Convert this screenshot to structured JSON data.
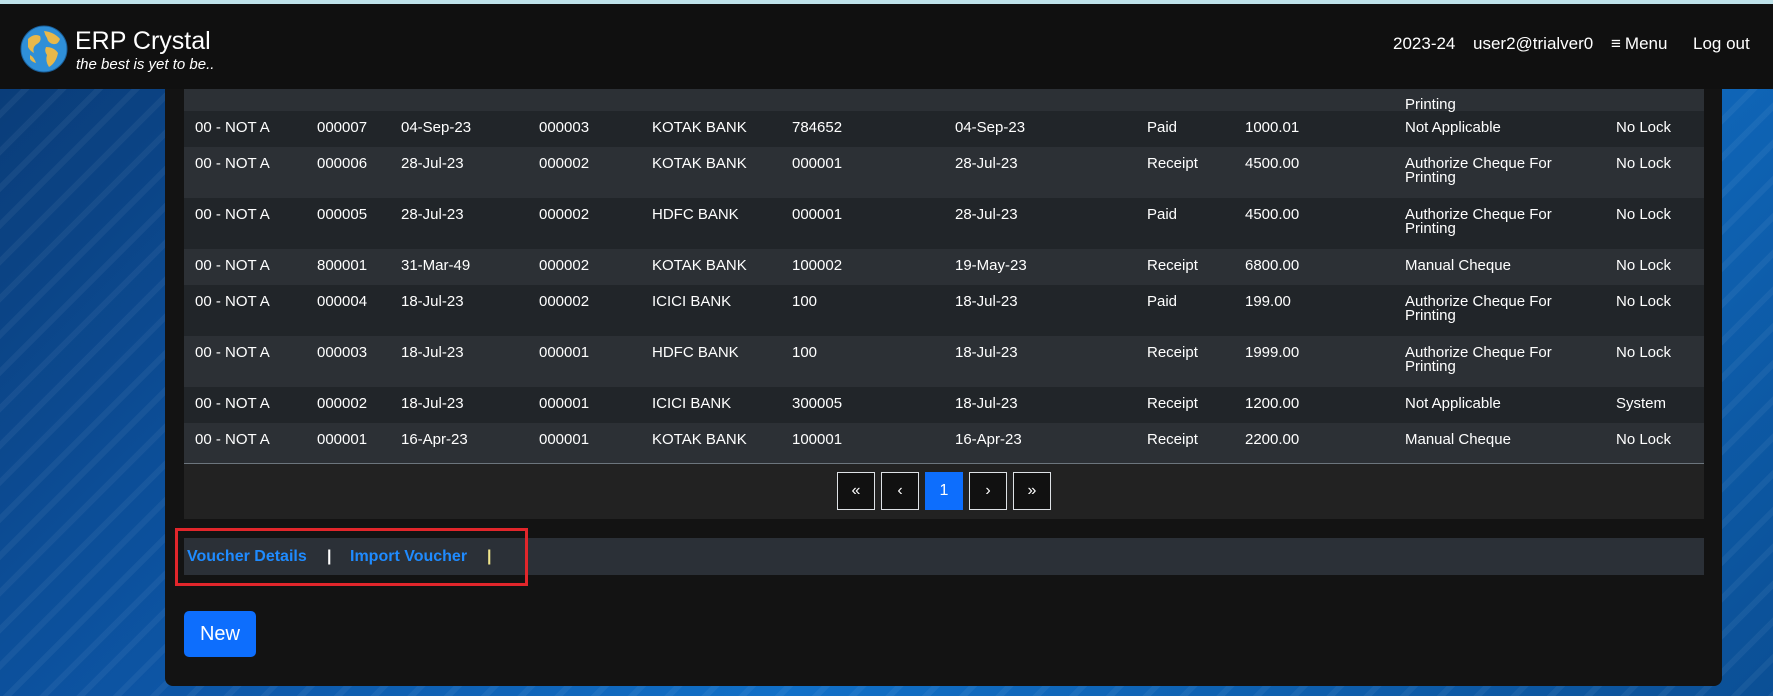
{
  "header": {
    "title": "ERP Crystal",
    "tagline": "the best is yet to be..",
    "year": "2023-24",
    "user": "user2@trialver0",
    "menu_label": "Menu",
    "logout_label": "Log out"
  },
  "partial_row": {
    "col9_line2": "Printing"
  },
  "rows": [
    {
      "c1": "00 - NOT A",
      "c2": "000007",
      "c3": "04-Sep-23",
      "c4": "000003",
      "c5": "KOTAK BANK",
      "c6": "784652",
      "c7": "04-Sep-23",
      "c8": "Paid",
      "c9": "1000.01",
      "c10a": "Not Applicable",
      "c10b": "",
      "c11": "No Lock"
    },
    {
      "c1": "00 - NOT A",
      "c2": "000006",
      "c3": "28-Jul-23",
      "c4": "000002",
      "c5": "KOTAK BANK",
      "c6": "000001",
      "c7": "28-Jul-23",
      "c8": "Receipt",
      "c9": "4500.00",
      "c10a": "Authorize Cheque For",
      "c10b": "Printing",
      "c11": "No Lock"
    },
    {
      "c1": "00 - NOT A",
      "c2": "000005",
      "c3": "28-Jul-23",
      "c4": "000002",
      "c5": "HDFC BANK",
      "c6": "000001",
      "c7": "28-Jul-23",
      "c8": "Paid",
      "c9": "4500.00",
      "c10a": "Authorize Cheque For",
      "c10b": "Printing",
      "c11": "No Lock"
    },
    {
      "c1": "00 - NOT A",
      "c2": "800001",
      "c3": "31-Mar-49",
      "c4": "000002",
      "c5": "KOTAK BANK",
      "c6": "100002",
      "c7": "19-May-23",
      "c8": "Receipt",
      "c9": "6800.00",
      "c10a": "Manual Cheque",
      "c10b": "",
      "c11": "No Lock"
    },
    {
      "c1": "00 - NOT A",
      "c2": "000004",
      "c3": "18-Jul-23",
      "c4": "000002",
      "c5": "ICICI BANK",
      "c6": "100",
      "c7": "18-Jul-23",
      "c8": "Paid",
      "c9": "199.00",
      "c10a": "Authorize Cheque For",
      "c10b": "Printing",
      "c11": "No Lock"
    },
    {
      "c1": "00 - NOT A",
      "c2": "000003",
      "c3": "18-Jul-23",
      "c4": "000001",
      "c5": "HDFC BANK",
      "c6": "100",
      "c7": "18-Jul-23",
      "c8": "Receipt",
      "c9": "1999.00",
      "c10a": "Authorize Cheque For",
      "c10b": "Printing",
      "c11": "No Lock"
    },
    {
      "c1": "00 - NOT A",
      "c2": "000002",
      "c3": "18-Jul-23",
      "c4": "000001",
      "c5": "ICICI BANK",
      "c6": "300005",
      "c7": "18-Jul-23",
      "c8": "Receipt",
      "c9": "1200.00",
      "c10a": "Not Applicable",
      "c10b": "",
      "c11": "System"
    },
    {
      "c1": "00 - NOT A",
      "c2": "000001",
      "c3": "16-Apr-23",
      "c4": "000001",
      "c5": "KOTAK BANK",
      "c6": "100001",
      "c7": "16-Apr-23",
      "c8": "Receipt",
      "c9": "2200.00",
      "c10a": "Manual Cheque",
      "c10b": "",
      "c11": "No Lock"
    }
  ],
  "pagination": {
    "first": "«",
    "prev": "‹",
    "current": "1",
    "next": "›",
    "last": "»"
  },
  "links": {
    "voucher_details": "Voucher Details",
    "separator": "|",
    "import_voucher": "Import Voucher"
  },
  "new_button": "New",
  "colors": {
    "accent": "#0d6efd",
    "link": "#1f8bff",
    "highlight": "#e2262b",
    "navbar": "#101010",
    "grid": "#212529"
  }
}
